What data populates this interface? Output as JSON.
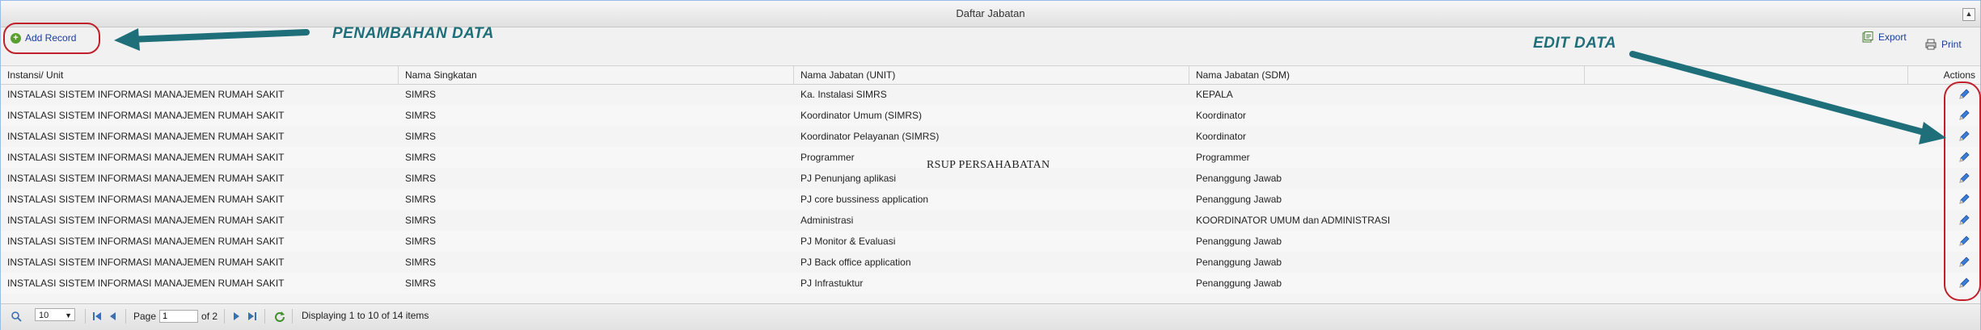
{
  "window": {
    "title": "Daftar Jabatan"
  },
  "toolbar": {
    "add_label": "Add Record",
    "export_label": "Export",
    "print_label": "Print"
  },
  "annotations": {
    "add_note": "PENAMBAHAN DATA",
    "edit_note": "EDIT DATA"
  },
  "watermark": "RSUP PERSAHABATAN",
  "columns": [
    "Instansi/ Unit",
    "Nama Singkatan",
    "Nama Jabatan (UNIT)",
    "Nama Jabatan (SDM)",
    "",
    "Actions"
  ],
  "rows": [
    [
      "INSTALASI SISTEM INFORMASI MANAJEMEN RUMAH SAKIT",
      "SIMRS",
      "Ka. Instalasi SIMRS",
      "KEPALA"
    ],
    [
      "INSTALASI SISTEM INFORMASI MANAJEMEN RUMAH SAKIT",
      "SIMRS",
      "Koordinator Umum (SIMRS)",
      "Koordinator"
    ],
    [
      "INSTALASI SISTEM INFORMASI MANAJEMEN RUMAH SAKIT",
      "SIMRS",
      "Koordinator Pelayanan (SIMRS)",
      "Koordinator"
    ],
    [
      "INSTALASI SISTEM INFORMASI MANAJEMEN RUMAH SAKIT",
      "SIMRS",
      "Programmer",
      "Programmer"
    ],
    [
      "INSTALASI SISTEM INFORMASI MANAJEMEN RUMAH SAKIT",
      "SIMRS",
      "PJ Penunjang aplikasi",
      "Penanggung Jawab"
    ],
    [
      "INSTALASI SISTEM INFORMASI MANAJEMEN RUMAH SAKIT",
      "SIMRS",
      "PJ core bussiness application",
      "Penanggung Jawab"
    ],
    [
      "INSTALASI SISTEM INFORMASI MANAJEMEN RUMAH SAKIT",
      "SIMRS",
      "Administrasi",
      "KOORDINATOR UMUM dan ADMINISTRASI"
    ],
    [
      "INSTALASI SISTEM INFORMASI MANAJEMEN RUMAH SAKIT",
      "SIMRS",
      "PJ Monitor & Evaluasi",
      "Penanggung Jawab"
    ],
    [
      "INSTALASI SISTEM INFORMASI MANAJEMEN RUMAH SAKIT",
      "SIMRS",
      "PJ Back office application",
      "Penanggung Jawab"
    ],
    [
      "INSTALASI SISTEM INFORMASI MANAJEMEN RUMAH SAKIT",
      "SIMRS",
      "PJ Infrastuktur",
      "Penanggung Jawab"
    ]
  ],
  "pager": {
    "page_size": "10",
    "page_label": "Page",
    "current_page": "1",
    "of_label": "of 2",
    "status": "Displaying 1 to 10 of 14 items"
  },
  "colors": {
    "annotation": "#1e6f7a",
    "highlight": "#c0202a",
    "link": "#1a3d9a"
  }
}
